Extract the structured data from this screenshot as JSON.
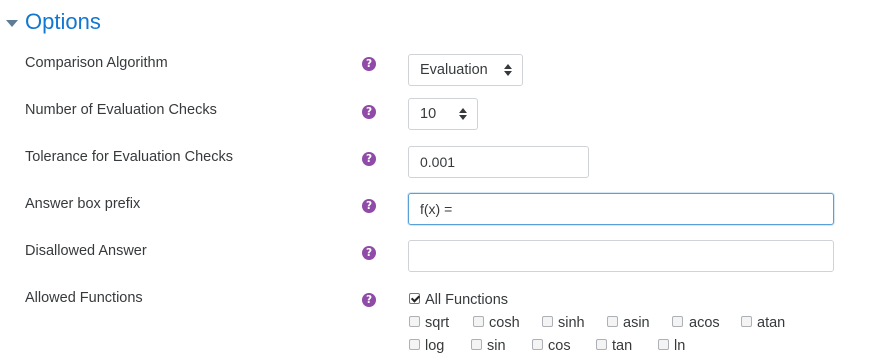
{
  "section": {
    "title": "Options"
  },
  "fields": {
    "comparison_algorithm": {
      "label": "Comparison Algorithm",
      "value": "Evaluation"
    },
    "evaluation_checks": {
      "label": "Number of Evaluation Checks",
      "value": "10"
    },
    "tolerance": {
      "label": "Tolerance for Evaluation Checks",
      "value": "0.001"
    },
    "answer_prefix": {
      "label": "Answer box prefix",
      "value": "f(x) ="
    },
    "disallowed_answer": {
      "label": "Disallowed Answer",
      "value": ""
    },
    "allowed_functions": {
      "label": "Allowed Functions",
      "all": {
        "label": "All Functions",
        "checked": true
      },
      "functions": [
        {
          "label": "sqrt",
          "checked": false
        },
        {
          "label": "cosh",
          "checked": false
        },
        {
          "label": "sinh",
          "checked": false
        },
        {
          "label": "asin",
          "checked": false
        },
        {
          "label": "acos",
          "checked": false
        },
        {
          "label": "atan",
          "checked": false
        },
        {
          "label": "log",
          "checked": false
        },
        {
          "label": "sin",
          "checked": false
        },
        {
          "label": "cos",
          "checked": false
        },
        {
          "label": "tan",
          "checked": false
        },
        {
          "label": "ln",
          "checked": false
        }
      ]
    }
  },
  "help_glyph": "?",
  "colors": {
    "title": "#1177d1",
    "help_icon": "#8f4ba7",
    "focus_border": "#5aa0d8"
  },
  "icons": {
    "collapse": "triangle-down-icon",
    "help": "question-circle-icon",
    "select": "sort-caret-icon"
  }
}
